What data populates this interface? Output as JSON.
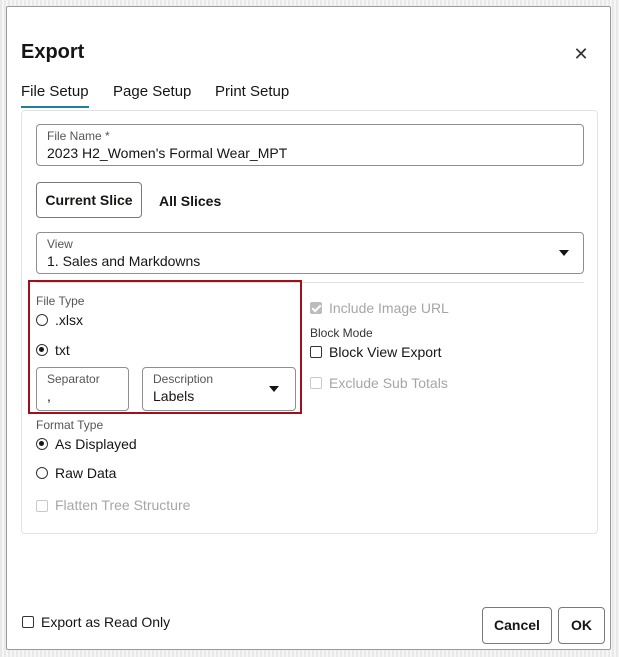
{
  "dialog": {
    "title": "Export",
    "close_label": "✕"
  },
  "tabs": [
    {
      "label": "File Setup",
      "active": true
    },
    {
      "label": "Page Setup",
      "active": false
    },
    {
      "label": "Print Setup",
      "active": false
    }
  ],
  "file_name": {
    "label": "File Name *",
    "value": "2023 H2_Women's Formal Wear_MPT"
  },
  "slices": {
    "current_label": "Current Slice",
    "all_label": "All Slices"
  },
  "view": {
    "label": "View",
    "value": "1. Sales and Markdowns"
  },
  "file_type": {
    "label": "File Type",
    "options": [
      {
        "label": ".xlsx",
        "selected": false
      },
      {
        "label": "txt",
        "selected": true
      }
    ]
  },
  "separator": {
    "label": "Separator",
    "value": ","
  },
  "description": {
    "label": "Description",
    "value": "Labels"
  },
  "format_type": {
    "label": "Format Type",
    "options": [
      {
        "label": "As Displayed",
        "selected": true
      },
      {
        "label": "Raw Data",
        "selected": false
      }
    ]
  },
  "flatten_tree": {
    "label": "Flatten Tree Structure",
    "checked": false,
    "disabled": true
  },
  "include_image_url": {
    "label": "Include Image URL",
    "checked": true,
    "disabled": true
  },
  "block_mode": {
    "label": "Block Mode",
    "block_view_export": {
      "label": "Block View Export",
      "checked": false
    },
    "exclude_sub_totals": {
      "label": "Exclude Sub Totals",
      "checked": false,
      "disabled": true
    }
  },
  "footer": {
    "export_read_only": {
      "label": "Export as Read Only",
      "checked": false
    },
    "cancel_label": "Cancel",
    "ok_label": "OK"
  },
  "colors": {
    "tab_accent": "#227e9e",
    "highlight_border": "#a10f1a"
  }
}
